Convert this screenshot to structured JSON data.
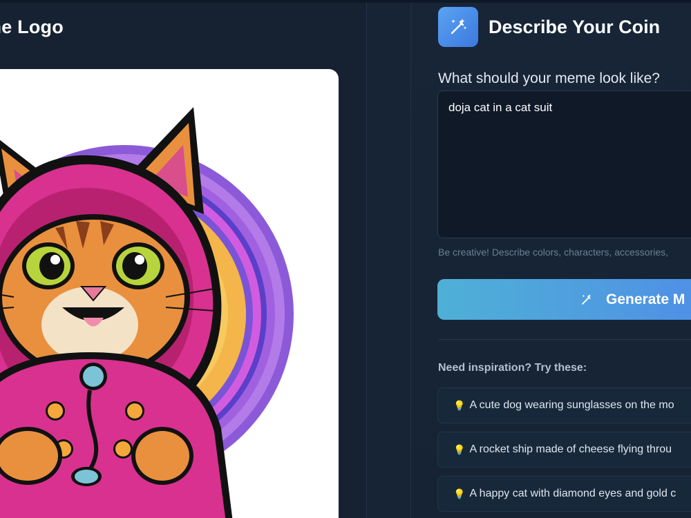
{
  "left": {
    "title": "me Logo",
    "image_alt": "cat in pink hoodie logo"
  },
  "right": {
    "title": "Describe Your Coin",
    "header_icon": "magic-wand-icon",
    "prompt_label": "What should your meme look like?",
    "prompt_value": "doja cat in a cat suit",
    "helper_text": "Be creative! Describe colors, characters, accessories,",
    "generate_button": "Generate M",
    "inspiration_title": "Need inspiration? Try these:",
    "suggestions": [
      {
        "icon": "lightbulb-icon",
        "text": "A cute dog wearing sunglasses on the mo"
      },
      {
        "icon": "lightbulb-icon",
        "text": "A rocket ship made of cheese flying throu"
      },
      {
        "icon": "lightbulb-icon",
        "text": "A happy cat with diamond eyes and gold c"
      }
    ]
  },
  "colors": {
    "background": "#15202f",
    "accent_blue": "#4f8fe6",
    "accent_cyan": "#4fb0d6",
    "hoodie_pink": "#d9318f",
    "ring_purple": "#9b5de5"
  }
}
